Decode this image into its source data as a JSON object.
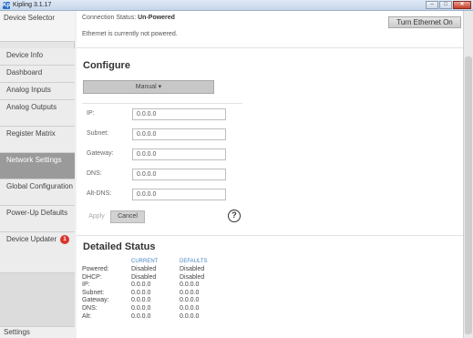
{
  "window": {
    "app_icon": "Kp",
    "title": "Kipling 3.1.17",
    "minimize": "–",
    "maximize": "□",
    "close": "✕"
  },
  "sidebar": {
    "device_selector": "Device Selector",
    "items": [
      {
        "label": "Device Info"
      },
      {
        "label": "Dashboard"
      },
      {
        "label": "Analog Inputs"
      },
      {
        "label": "Analog Outputs"
      },
      {
        "label": "Register Matrix"
      },
      {
        "label": "Network Settings",
        "active": true
      },
      {
        "label": "Global Configuration"
      },
      {
        "label": "Power-Up Defaults"
      },
      {
        "label": "Device Updater",
        "badge": "1"
      }
    ],
    "settings": "Settings"
  },
  "header": {
    "connection_label": "Connection Status:",
    "connection_value": "Un-Powered",
    "ethernet_message": "Ethernet is currently not powered.",
    "turn_on_button": "Turn Ethernet On"
  },
  "configure": {
    "title": "Configure",
    "mode_button": "Manual ▾",
    "fields": [
      {
        "label": "IP:",
        "value": "0.0.0.0"
      },
      {
        "label": "Subnet:",
        "value": "0.0.0.0"
      },
      {
        "label": "Gateway:",
        "value": "0.0.0.0"
      },
      {
        "label": "DNS:",
        "value": "0.0.0.0"
      },
      {
        "label": "Alt-DNS:",
        "value": "0.0.0.0"
      }
    ],
    "apply": "Apply",
    "cancel": "Cancel",
    "help": "?"
  },
  "status": {
    "title": "Detailed Status",
    "col_current": "CURRENT",
    "col_defaults": "DEFAULTS",
    "rows": [
      {
        "name": "Powered:",
        "current": "Disabled",
        "defaults": "Disabled"
      },
      {
        "name": "DHCP:",
        "current": "Disabled",
        "defaults": "Disabled"
      },
      {
        "name": "IP:",
        "current": "0.0.0.0",
        "defaults": "0.0.0.0"
      },
      {
        "name": "Subnet:",
        "current": "0.0.0.0",
        "defaults": "0.0.0.0"
      },
      {
        "name": "Gateway:",
        "current": "0.0.0.0",
        "defaults": "0.0.0.0"
      },
      {
        "name": "DNS:",
        "current": "0.0.0.0",
        "defaults": "0.0.0.0"
      },
      {
        "name": "Alt:",
        "current": "0.0.0.0",
        "defaults": "0.0.0.0"
      }
    ]
  }
}
